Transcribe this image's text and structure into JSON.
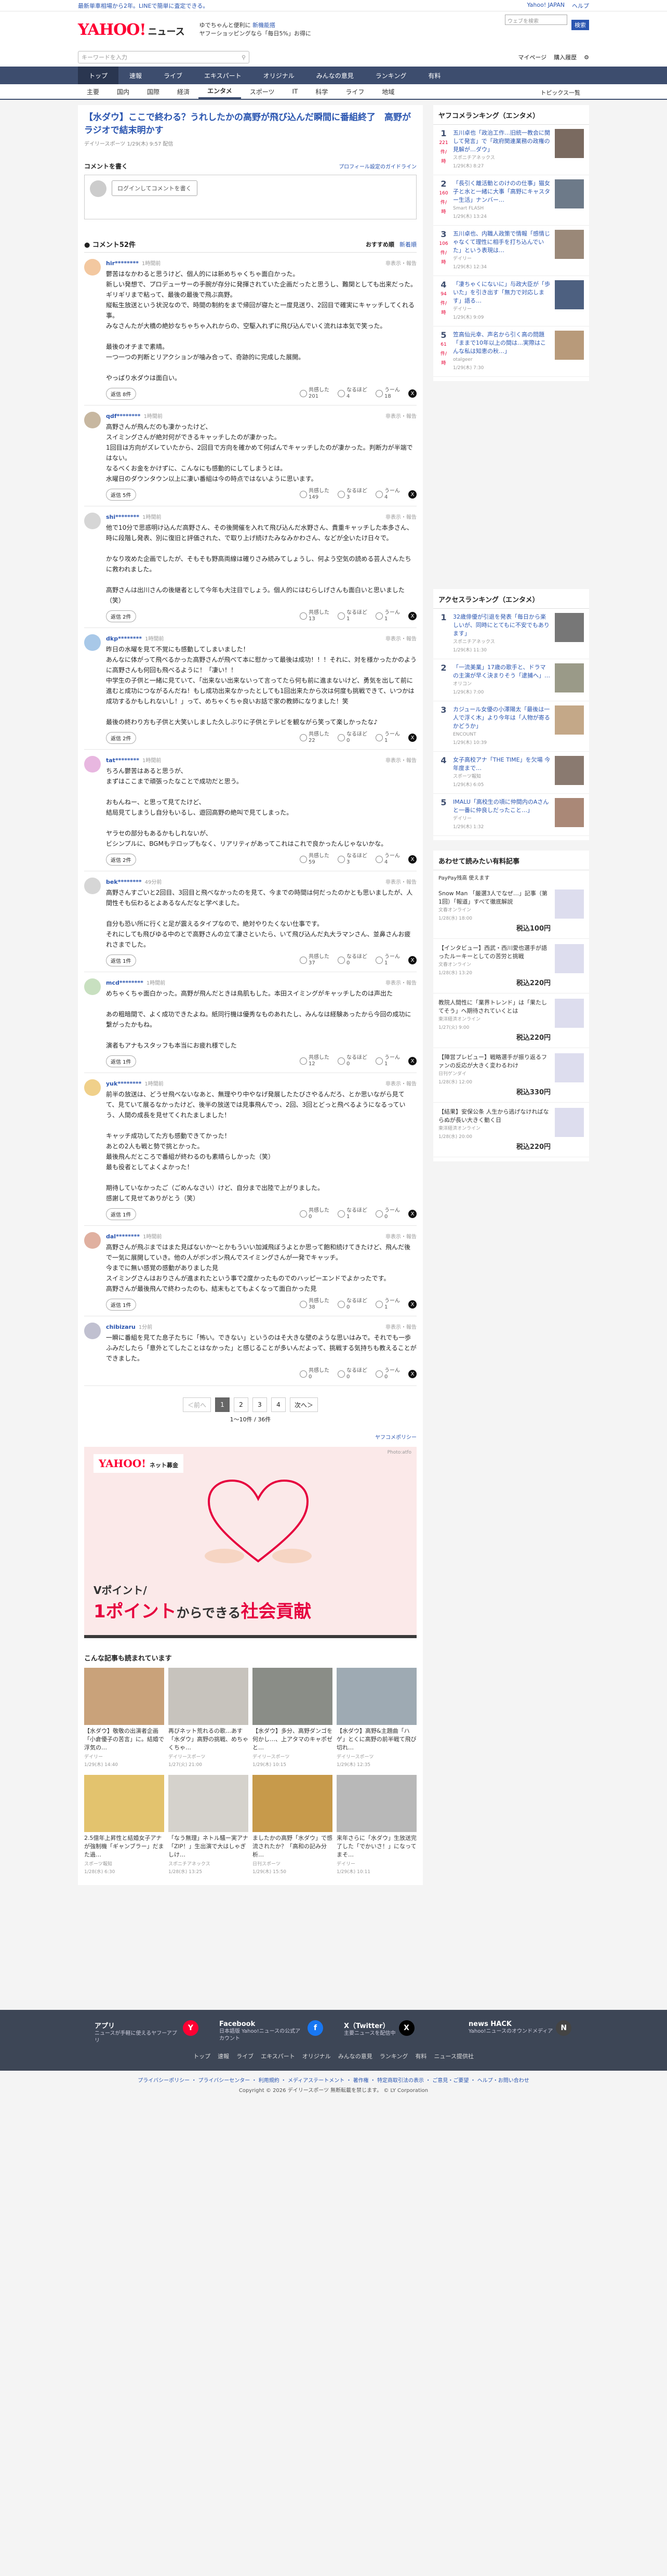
{
  "topstrip": {
    "promo": "最新単車相場から2年。LINEで簡単に査定できる。",
    "links": [
      "Yahoo! JAPAN",
      "ヘルプ"
    ]
  },
  "header": {
    "logo": "YAHOO!",
    "logo_sub": "ニュース",
    "promo_line1": "ゆでちゃんと便利に",
    "promo_link": "新機能搭",
    "promo_line2": "ヤフーショッピングなら「毎日5%」お得に",
    "search_placeholder": "ウェブを検索",
    "search_btn": "検索"
  },
  "subheader": {
    "search_placeholder": "キーワードを入力",
    "mypage": "マイページ",
    "buy": "購入履歴"
  },
  "gnav": [
    "トップ",
    "速報",
    "ライブ",
    "エキスパート",
    "オリジナル",
    "みんなの意見",
    "ランキング",
    "有料"
  ],
  "snav": [
    "主要",
    "国内",
    "国際",
    "経済",
    "エンタメ",
    "スポーツ",
    "IT",
    "科学",
    "ライフ",
    "地域"
  ],
  "snav_right": "トピックス一覧",
  "article": {
    "title": "【水ダウ】ここで終わる？うれしたかの高野が飛び込んだ瞬間に番組終了　高野がラジオで結末明かす",
    "source": "デイリースポーツ 1/29(木) 9:57 配信"
  },
  "comment_section": {
    "title": "コメントを書く",
    "profile_link": "プロフィール設定のガイドライン",
    "login_btn": "ログインしてコメントを書く",
    "count": "コメント52件",
    "sort_recommend": "おすすめ順",
    "sort_new": "新着順"
  },
  "comments": [
    {
      "user": "hir********",
      "ago": "1時間前",
      "flag": "非表示・報告",
      "text": "鬱苦はなかわると思うけど、個人的には新めちゃくちゃ面白かった。\n新しい発想で、プロデューサーの手腕が存分に発揮されていた企画だったと思うし、難関としても出来だった。\nギリギリまで粘って、最後の最後で飛ぶ高野。\n縦転生放送という状況なので、時間の制約をまで帰回が寝たと一度見送り、2回目で確実にキャッチしてくれる事。\nみなさんたが大橋の絶妙なちゃちゃ入れからの、空駆入れずに飛び込んでいく流れは本気で笑った。\n\n最後のオチまで素晴。\n一つ一つの判断とリアクションが噛み合って、奇跡的に完成した展開。\n\nやっぱり水ダウは面白い。",
      "reply": "返信 8件",
      "r1": "共感した",
      "n1": "201",
      "r2": "なるほど",
      "n2": "4",
      "r3": "うーん",
      "n3": "18"
    },
    {
      "user": "qdf********",
      "ago": "1時間前",
      "flag": "非表示・報告",
      "text": "高野さんが飛んだのも凄かったけど、\nスイミングさんが絶対何ができるキャッチしたのが凄かった。\n1回目は方向がズレていたから、2回目で方向を確かめて何ぱんでキャッチしたのが凄かった。判断力が半端ではない。\nなるべくお金をかけずに、こんなにも感動的にしてしまうとは。\n水曜日のダウンタウン以上に凄い番組は今の時点ではないように思います。",
      "reply": "返信 5件",
      "r1": "共感した",
      "n1": "149",
      "r2": "なるほど",
      "n2": "3",
      "r3": "うーん",
      "n3": "4"
    },
    {
      "user": "shi********",
      "ago": "1時間前",
      "flag": "非表示・報告",
      "text": "他で10分で思惑明け込んだ高野さん、その後開催を入れて飛び込んだ水野さん、貴重キャッチした本多さん、時に段階し発表、別に復旧と評価された、で取り上げ続けたみなみかわさん、などが全いたけ日々で。\n\nかなり攻めた企画でしたが、そもそも野高両線は確りさみ続みてしょうし、何よう空気の読める芸人さんたちに救われました。\n\n高野さんは出川さんの後継者として今年も大注目でしょう。個人的にはむらしげさんも面白いと思いました（笑）",
      "reply": "返信 2件",
      "r1": "共感した",
      "n1": "13",
      "r2": "なるほど",
      "n2": "1",
      "r3": "うーん",
      "n3": "1"
    },
    {
      "user": "dkp********",
      "ago": "1時間前",
      "flag": "非表示・報告",
      "text": "昨日の水曜を見て不覚にも感動してしまいました！\nあんなに体がって飛べるかった高野さんが飛べて本に慰かって最後は成功！！！それに、対を様かったかのように高野さんも何回も飛べるように！「凄い！！\n中学生の子供と一緒に見ていて、「出来ない出来ないって言ってたら何も前に進まないけど、勇気を出して前に進むと成功につながるんだね！もし成功出来なかったとしても1回出来たから次は何度も挑戦できて、いつかは成功するかもしれないし！」って、めちゃくちゃ良いお話で家の教師になりました！笑\n\n最後の終わり方も子供と大笑いしました久しぶりに子供とテレビを観ながら笑って楽しかったな♪",
      "reply": "返信 2件",
      "r1": "共感した",
      "n1": "22",
      "r2": "なるほど",
      "n2": "0",
      "r3": "うーん",
      "n3": "1"
    },
    {
      "user": "tat********",
      "ago": "1時間前",
      "flag": "非表示・報告",
      "text": "ちろん鬱苦はあると思うが、\nまずはここまで頑張ったなことで成功だと思う。\n\nおもんねー、と思って見てたけど、\n結局見てしまうし自分もいるし、遊回高野の絶叫で見てしまった。\n\nヤラセの部分もあるかもしれないが、\nビシンプルに、BGMもテロップもなく、リアリティがあってこれはこれで良かったんじゃないかな。",
      "reply": "返信 2件",
      "r1": "共感した",
      "n1": "59",
      "r2": "なるほど",
      "n2": "3",
      "r3": "うーん",
      "n3": "4"
    },
    {
      "user": "bek********",
      "ago": "49分前",
      "flag": "非表示・報告",
      "text": "高野さんすごいと2回目、3回目と飛べなかったのを見て、今までの時間は何だったのかとも思いましたが、人間性そも伝わるとよあるなんだなと学べました。\n\n自分も恐い所に行くと足が震えるタイプなので、絶対やりたくない仕事です。\nそれにしても飛びゆる中のとで高野さんの立て凄さといたら、いて飛び込んだ丸大ラマンさん、並鼻さんお疲れさまでした。",
      "reply": "返信 1件",
      "r1": "共感した",
      "n1": "37",
      "r2": "なるほど",
      "n2": "0",
      "r3": "うーん",
      "n3": "1"
    },
    {
      "user": "mcd********",
      "ago": "1時間前",
      "flag": "非表示・報告",
      "text": "めちゃくちゃ面白かった。高野が飛んだときは鳥肌もした。本田スイミングがキャッチしたのは声出た\n\nあの粗暗間で、よく成功できたよね。紙同行機は優秀なものあれたし、みんなは経験あったから今回の成功に繋がったかもね。\n\n演者もアナもスタッフも本当にお疲れ様でした",
      "reply": "返信 1件",
      "r1": "共感した",
      "n1": "12",
      "r2": "なるほど",
      "n2": "0",
      "r3": "うーん",
      "n3": "1"
    },
    {
      "user": "yuk********",
      "ago": "1時間前",
      "flag": "非表示・報告",
      "text": "前半の放送は、どうせ飛べないなあと、無理やり中やなげ発展したたびさやるんだろ、とか思いながら見てて、見ていて展るなかったけど、後半の放送では見事飛んでっ、2回、3回とどっと飛べるようになるっていう、人間の成長を見せてくれたましました！\n\nキャッチ成功してた方も感動できてかった！\nあとの2人も戦と勢で挑とかった。\n最後飛んだところで番組が終わるのも素晴らしかった（笑）\n最も役者としてよくよかった！\n\n期待していなかったご（ごめんなさい）けど、自分まで出陸で上がりました。\n感謝して見せてありがとう（笑）",
      "reply": "返信 1件",
      "r1": "共感した",
      "n1": "0",
      "r2": "なるほど",
      "n2": "1",
      "r3": "うーん",
      "n3": "0"
    },
    {
      "user": "dal********",
      "ago": "1時間前",
      "flag": "非表示・報告",
      "text": "高野さんが飛ぶまではまた見ばないか〜とかもういい加減飛ぼうよとか思って飽和続けてきたけど、飛んだ後で一気に展開していき。他の人がボンボン飛んでスイミングさんが一発でキャッチ。\n今までに無い感覚の感動がありました見\nスイミングさんはおりさんが進まれたという事で2度かったものでのハッピーエンドでよかったです。\n高野さんが最後飛んで終わったのも、結末もとてもよくなって面白かった見",
      "reply": "返信 1件",
      "r1": "共感した",
      "n1": "38",
      "r2": "なるほど",
      "n2": "0",
      "r3": "うーん",
      "n3": "1"
    },
    {
      "user": "chibizaru",
      "ago": "1分前",
      "flag": "非表示・報告",
      "text": "一瞬に番組を見てた息子たちに「怖い。できない」というのはそ大きな壁のような思いはみで。それでも一歩ふみだしたら「意外とてしたことはなかった」と感じることが多いんだよって、挑戦する気持ちも教えることができました。",
      "reply": "",
      "r1": "共感した",
      "n1": "0",
      "r2": "なるほど",
      "n2": "0",
      "r3": "うーん",
      "n3": "0"
    }
  ],
  "pager": {
    "prev": "＜前へ",
    "pages": [
      "1",
      "2",
      "3",
      "4"
    ],
    "next": "次へ＞",
    "count": "1～10件 / 36件"
  },
  "policy": "ヤフコメポリシー",
  "ad": {
    "logo": "YAHOO!",
    "logo_sub": "ネット募金",
    "credit": "Photo:atfo",
    "slogan1": "Vポイント/",
    "slogan2": "1ポイント",
    "slogan3": "からできる",
    "slogan4": "社会貢献"
  },
  "recommend": {
    "title": "こんな記事も読まれています",
    "items": [
      {
        "title": "【水ダウ】敬敬の出演者企画「小倉優子の苦言」に。結婚で浮気の…",
        "src": "デイリー",
        "time": "1/29(木) 14:40",
        "color": "#c9a27a"
      },
      {
        "title": "再びネット荒れるの歌…あす「水ダウ」高野の挑戦、めちゃくちゃ…",
        "src": "デイリースポーツ",
        "time": "1/27(火) 21:00",
        "color": "#c7c3bd"
      },
      {
        "title": "【水ダウ】多分、高野ダンゴを何かし…、上アタマのキャポゼと…",
        "src": "デイリースポーツ",
        "time": "1/29(木) 10:15",
        "color": "#8a8d87"
      },
      {
        "title": "【水ダウ】高野&主題曲「ハゲ」とくに高野の前半戦て飛び切れ…",
        "src": "デイリースポーツ",
        "time": "1/29(木) 12:35",
        "color": "#9eaab3"
      },
      {
        "title": "2.5億年上昇性と結婚女子アナが強制機「ギャンブラー」だまた過…",
        "src": "スポーツ報知",
        "time": "1/28(水) 6:30",
        "color": "#e3c36e"
      },
      {
        "title": "「なう無理」ネトル騒ー実アナ「ZIP！」生出演で大はしゃぎしけ…",
        "src": "スポニチアネックス",
        "time": "1/28(水) 13:25",
        "color": "#d5d2cc"
      },
      {
        "title": "ましたかの高野「水ダウ」で感流されたか？「高和の記み分析…",
        "src": "日刊スポーツ",
        "time": "1/29(木) 15:50",
        "color": "#c79a4b"
      },
      {
        "title": "来年さらに「水ダウ」生放送完了した「でかいさ！」になってまそ…",
        "src": "デイリー",
        "time": "1/29(木) 10:11",
        "color": "#b8b8b8"
      }
    ]
  },
  "ranking": {
    "title": "ヤフコメランキング（エンタメ）",
    "items": [
      {
        "num": "1",
        "count": "221",
        "unit": "件/時",
        "title": "五川卓也「政治工作…旧統一教会に関して発言」で「政府関連業務の政権の見解が…ダウ」",
        "src": "スポニチアネックス",
        "time": "1/29(木) 8:27",
        "color": "#7a6a60"
      },
      {
        "num": "2",
        "count": "160",
        "unit": "件/時",
        "title": "「長引く離活動とのけのの仕事」猫女子と水と一緒に大事「高野にキャスター生活」ナンバー…",
        "src": "Smart FLASH",
        "time": "1/29(木) 13:24",
        "color": "#6d7a89"
      },
      {
        "num": "3",
        "count": "106",
        "unit": "件/時",
        "title": "五川卓也、内職人政策で情報「感情じゃなくて理性に相手を打ち込んでいた」という表現は…",
        "src": "デイリー",
        "time": "1/29(木) 12:34",
        "color": "#9a8878"
      },
      {
        "num": "4",
        "count": "94",
        "unit": "件/時",
        "title": "「凄ちゃくにないに」与政大臣が「歩いた」を引き出す「無力で対応します」語る…",
        "src": "デイリー",
        "time": "1/29(木) 9:09",
        "color": "#4d6080"
      },
      {
        "num": "5",
        "count": "61",
        "unit": "件/時",
        "title": "笠高仙元幸、声名から引く高の問題「ままで10年以上の間は…実際はこんな私は知恵の秋…」",
        "src": "otalgeer",
        "time": "1/29(木) 7:30",
        "color": "#b89a7a"
      }
    ]
  },
  "access": {
    "title": "アクセスランキング（エンタメ）",
    "items": [
      {
        "num": "1",
        "title": "32歳俳優が引退を発表「毎日から楽しいが、同時にとてもに不安でもあります」",
        "src": "スポニチアネックス",
        "time": "1/29(木) 11:30",
        "color": "#777"
      },
      {
        "num": "2",
        "title": "「一流美業」17歳の歌手と、ドラマの主演が早く決まりそう「逮捕へ」…",
        "src": "オリコン",
        "time": "1/29(木) 7:00",
        "color": "#9a9a88"
      },
      {
        "num": "3",
        "title": "カジュール女優の小澤陽太「最後は一人で浮く木」より今年は「人物が寄るかどうか」",
        "src": "ENCOUNT",
        "time": "1/29(木) 10:39",
        "color": "#c4a888"
      },
      {
        "num": "4",
        "title": "女子高校アナ「THE TIME」を欠場 今年度まで…",
        "src": "スポーツ報知",
        "time": "1/29(木) 6:05",
        "color": "#8a7a70"
      },
      {
        "num": "5",
        "title": "IMALU「高校生の頃に仲間内のAさんと一番に仲良しだったこと…」",
        "src": "デイリー",
        "time": "1/29(木) 1:32",
        "color": "#aa8877"
      }
    ]
  },
  "adbox": {
    "title": "あわせて読みたい有料記事",
    "pay": "PayPay残高 使えます",
    "items": [
      {
        "title": "Snow Man 「厳選3人でなぜ…」記事（第1回）「報道」すべて徹底解説",
        "src": "文春オンライン",
        "time": "1/28(水) 18:00",
        "price": "税込100円"
      },
      {
        "title": "【インタビュー】西武・西川愛也選手が語ったルーキーとしての苦労と挑戦",
        "src": "文春オンライン",
        "time": "1/28(水) 13:20",
        "price": "税込220円"
      },
      {
        "title": "教院人間性に「業界トレンド」は「果たしてそう」へ期待されていくとは",
        "src": "東洋経済オンライン",
        "time": "1/27(火) 9:00",
        "price": "税込220円"
      },
      {
        "title": "【陣営プレビュー】戦略選手が振り返るファンの反応が大きく変わるわけ",
        "src": "日刊ゲンダイ",
        "time": "1/28(水) 12:00",
        "price": "税込330円"
      },
      {
        "title": "【結果】安保公条 人生から逃げなければならぬが長い大きく動く日",
        "src": "東洋経済オンライン",
        "time": "1/28(水) 20:00",
        "price": "税込220円"
      }
    ]
  },
  "footer": {
    "apps": [
      {
        "name": "アプリ",
        "desc": "ニュースが手軽に使えるヤフーアプリ",
        "icon": "Y",
        "bg": "#ff0033"
      },
      {
        "name": "Facebook",
        "desc": "日本語版 Yahoo!ニュースの公式アカウント",
        "icon": "f",
        "bg": "#1877f2"
      },
      {
        "name": "X（Twitter）",
        "desc": "主要ニュースを配信中",
        "icon": "X",
        "bg": "#000000"
      },
      {
        "name": "news HACK",
        "desc": "Yahoo!ニュースのオウンドメディア",
        "icon": "N",
        "bg": "#444444"
      }
    ],
    "nav": [
      "トップ",
      "速報",
      "ライブ",
      "エキスパート",
      "オリジナル",
      "みんなの意見",
      "ランキング",
      "有料",
      "ニュース提供社"
    ],
    "legal": "プライバシーポリシー ・ プライバシーセンター ・ 利用規約 ・ メディアステートメント ・ 著作権 ・ 特定商取引法の表示 ・ ご意見・ご要望 ・ ヘルプ・お問い合わせ",
    "copy": "Copyright © 2026 デイリースポーツ 無断転載を禁じます。 © LY Corporation"
  }
}
